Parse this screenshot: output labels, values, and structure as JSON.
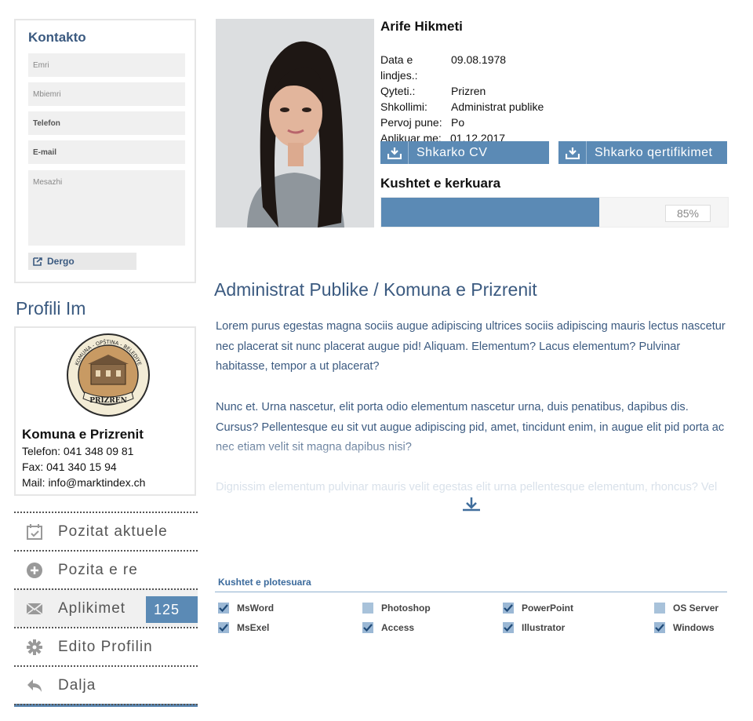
{
  "contact": {
    "title": "Kontakto",
    "fields": {
      "name": "Emri",
      "surname": "Mbiemri",
      "phone": "Telefon",
      "email": "E-mail",
      "message": "Mesazhi"
    },
    "send_label": "Dergo"
  },
  "profile": {
    "heading": "Profili Im",
    "org_name": "Komuna e Prizrenit",
    "phone": "Telefon: 041 348 09 81",
    "fax": "Fax: 041 340 15 94",
    "mail": "Mail: info@marktindex.ch",
    "seal_text_top": "KOMUNA - OPŠTINA - BELEDIYE",
    "seal_text_bottom": "PRIZREN"
  },
  "menu": [
    {
      "label": "Pozitat aktuele",
      "icon": "calendar-check-icon"
    },
    {
      "label": "Pozita e re",
      "icon": "plus-circle-icon"
    },
    {
      "label": "Aplikimet",
      "icon": "envelope-icon",
      "badge": "125"
    },
    {
      "label": "Edito Profilin",
      "icon": "gear-icon"
    },
    {
      "label": "Dalja",
      "icon": "reply-icon"
    }
  ],
  "candidate": {
    "name": "Arife Hikmeti",
    "info": [
      {
        "label": "Data e lindjes.:",
        "value": "09.08.1978"
      },
      {
        "label": "Qyteti.:",
        "value": "Prizren"
      },
      {
        "label": "Shkollimi:",
        "value": "Administrat publike"
      },
      {
        "label": "Pervoj pune:",
        "value": "Po"
      },
      {
        "label": "Aplikuar me:",
        "value": "01.12.2017"
      }
    ],
    "download_cv": "Shkarko CV",
    "download_cert": "Shkarko qertifikimet",
    "requirements_title": "Kushtet e kerkuara",
    "progress": 0.85,
    "progress_label": "85%"
  },
  "job": {
    "title": "Administrat Publike / Komuna e Prizrenit",
    "para1": "Lorem purus egestas magna sociis augue adipiscing ultrices sociis adipiscing mauris lectus nascetur nec placerat sit nunc placerat augue pid! Aliquam. Elementum? Lacus elementum? Pulvinar habitasse, tempor a ut placerat?",
    "para2": "Nunc et. Urna nascetur, elit porta odio elementum nascetur urna, duis penatibus, dapibus dis. Cursus? Pellentesque eu sit vut augue adipiscing pid, amet, tincidunt enim, in augue elit pid porta ac nec etiam velit sit magna dapibus nisi?",
    "para3": "Dignissim elementum pulvinar mauris velit egestas elit urna pellentesque elementum, rhoncus? Vel"
  },
  "requirements_met": {
    "title": "Kushtet e plotesuara",
    "skills": [
      {
        "label": "MsWord",
        "checked": true
      },
      {
        "label": "Photoshop",
        "checked": false
      },
      {
        "label": "PowerPoint",
        "checked": true
      },
      {
        "label": "OS Server",
        "checked": false
      },
      {
        "label": "MsExel",
        "checked": true
      },
      {
        "label": "Access",
        "checked": true
      },
      {
        "label": "Illustrator",
        "checked": true
      },
      {
        "label": "Windows",
        "checked": true
      }
    ]
  },
  "colors": {
    "accent": "#5b8ab5",
    "heading": "#3b5a80"
  }
}
